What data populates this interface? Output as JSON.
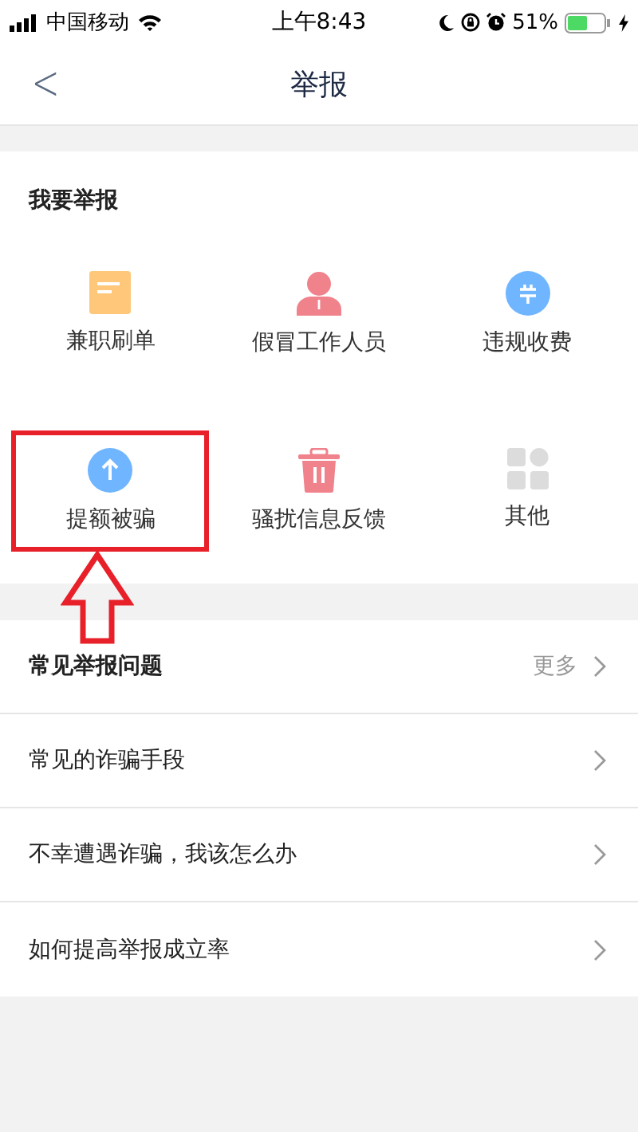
{
  "status_bar": {
    "carrier": "中国移动",
    "time": "上午8:43",
    "battery": "51%"
  },
  "nav": {
    "back": "<",
    "title": "举报"
  },
  "report": {
    "heading": "我要举报",
    "items": [
      {
        "label": "兼职刷单",
        "selected": false
      },
      {
        "label": "假冒工作人员",
        "selected": false
      },
      {
        "label": "违规收费",
        "selected": false
      },
      {
        "label": "提额被骗",
        "selected": true
      },
      {
        "label": "骚扰信息反馈",
        "selected": false
      },
      {
        "label": "其他",
        "selected": false
      }
    ]
  },
  "faq": {
    "heading": "常见举报问题",
    "more": "更多",
    "items": [
      "常见的诈骗手段",
      "不幸遭遇诈骗，我该怎么办",
      "如何提高举报成立率"
    ]
  }
}
